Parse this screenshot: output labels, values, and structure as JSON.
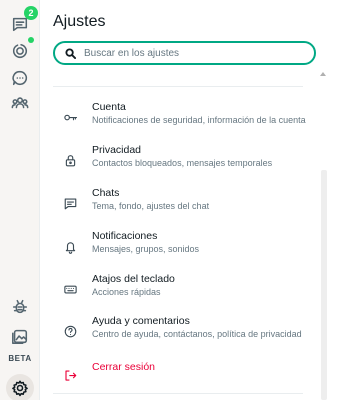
{
  "rail": {
    "chats_badge": "2",
    "beta_label": "BETA",
    "icons": [
      "chats-icon",
      "status-icon",
      "channels-icon",
      "communities-icon",
      "bug-report-icon",
      "media-icon",
      "settings-icon"
    ]
  },
  "settings": {
    "title": "Ajustes",
    "search_placeholder": "Buscar en los ajustes",
    "items": [
      {
        "title": "Cuenta",
        "subtitle": "Notificaciones de seguridad, información de la cuenta",
        "icon": "key-icon"
      },
      {
        "title": "Privacidad",
        "subtitle": "Contactos bloqueados, mensajes temporales",
        "icon": "lock-icon"
      },
      {
        "title": "Chats",
        "subtitle": "Tema, fondo, ajustes del chat",
        "icon": "chat-icon"
      },
      {
        "title": "Notificaciones",
        "subtitle": "Mensajes, grupos, sonidos",
        "icon": "bell-icon"
      },
      {
        "title": "Atajos del teclado",
        "subtitle": "Acciones rápidas",
        "icon": "keyboard-icon"
      },
      {
        "title": "Ayuda y comentarios",
        "subtitle": "Centro de ayuda, contáctanos, política de privacidad",
        "icon": "help-icon"
      }
    ],
    "logout": {
      "title": "Cerrar sesión",
      "icon": "logout-icon"
    }
  },
  "colors": {
    "accent": "#00a884",
    "badge": "#25d366",
    "danger": "#ea0038"
  }
}
